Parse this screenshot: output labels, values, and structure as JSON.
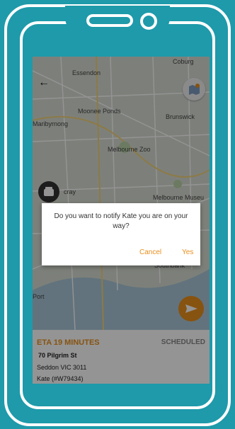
{
  "map": {
    "labels": [
      "Coburg",
      "Essendon",
      "Moonee Ponds",
      "Brunswick",
      "Maribyrnong",
      "Melbourne Zoo",
      "Melbourne Museu",
      "Southbank",
      "cray",
      "Port"
    ]
  },
  "info": {
    "eta": "ETA 19 MINUTES",
    "status": "SCHEDULED",
    "address_line1": "70 Pilgrim St",
    "address_line2": "Seddon VIC 3011",
    "customer": "Kate (#W79434)"
  },
  "dialog": {
    "message": "Do you want to notify Kate you are on your way?",
    "cancel_label": "Cancel",
    "confirm_label": "Yes"
  },
  "colors": {
    "frame": "#1e9aaa",
    "accent": "#e98f1d"
  }
}
